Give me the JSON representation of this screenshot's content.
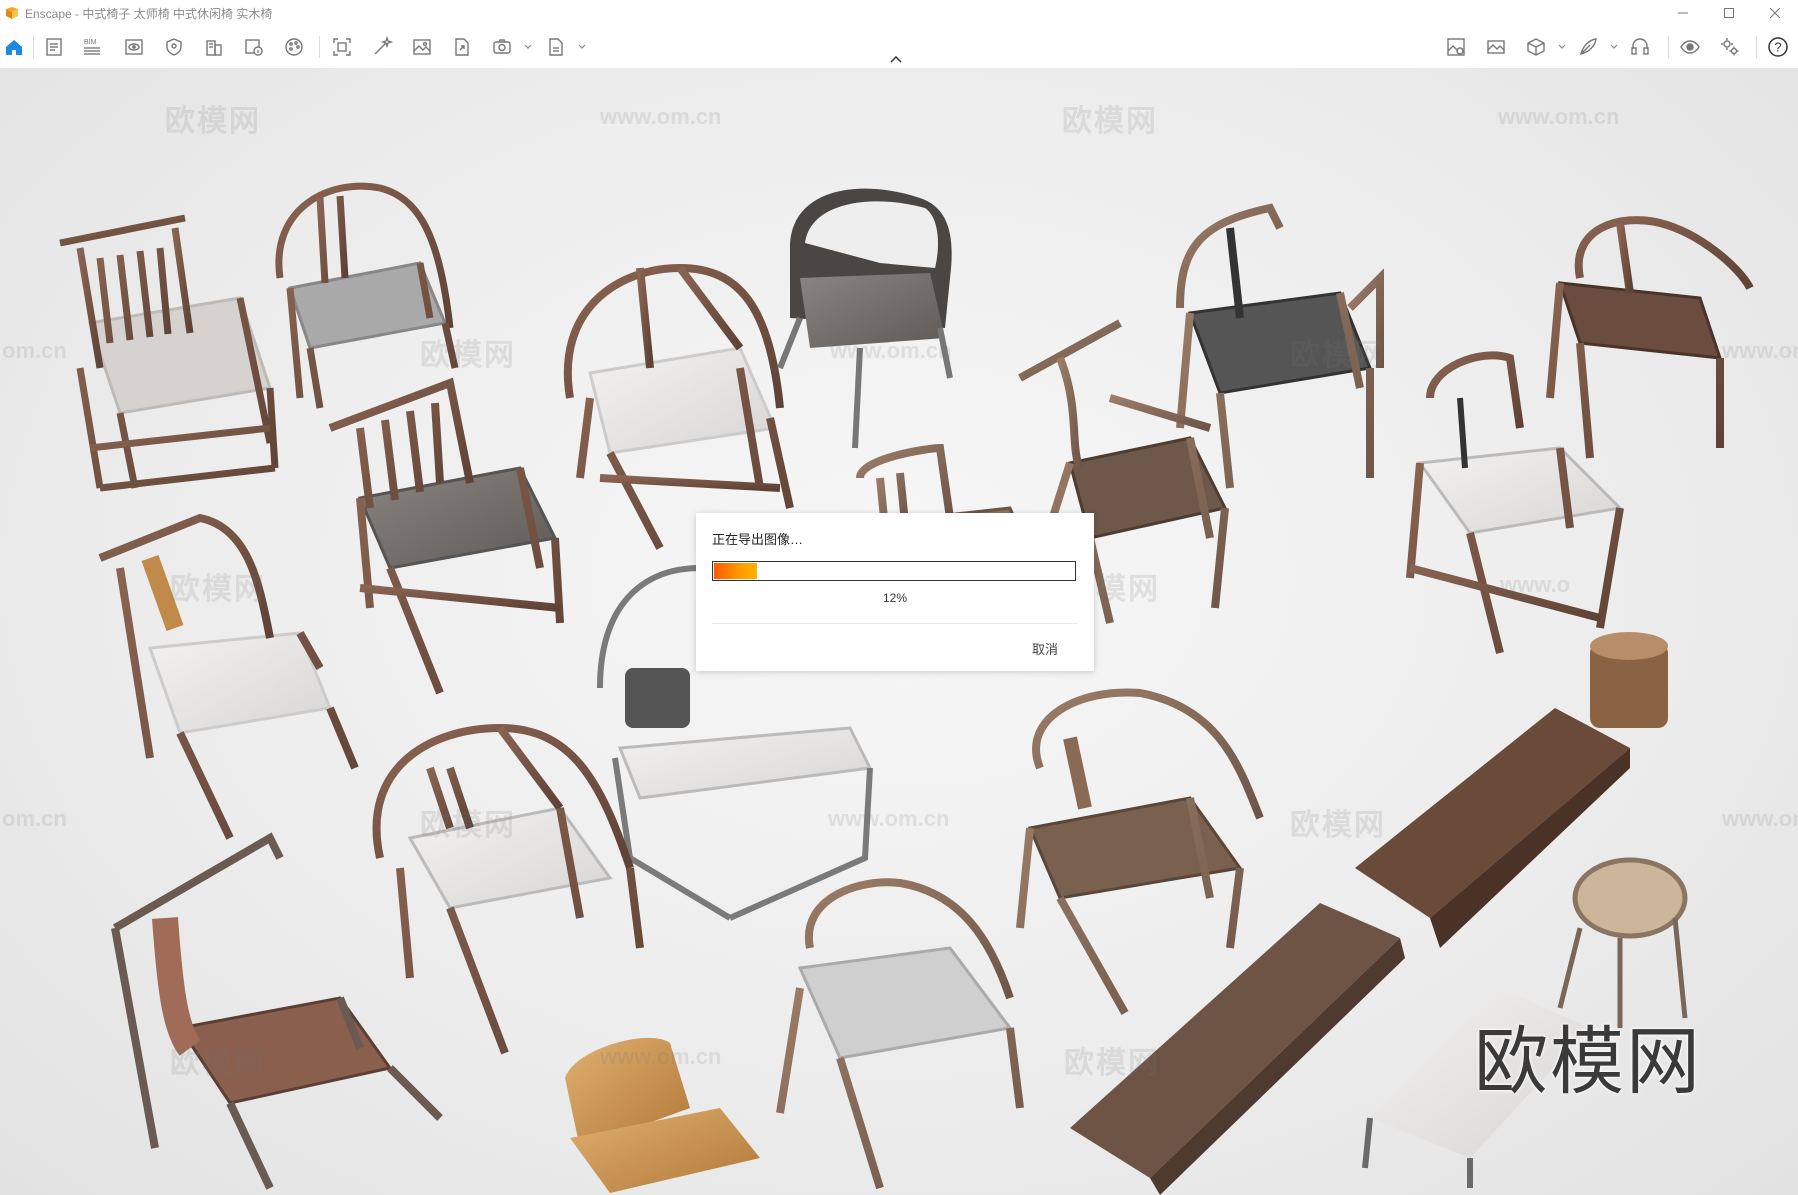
{
  "app": {
    "title": "Enscape - 中式椅子 太师椅 中式休闲椅 实木椅",
    "accent_color": "#f5a623"
  },
  "window_controls": {
    "minimize_icon": "minimize-icon",
    "maximize_icon": "maximize-icon",
    "close_icon": "close-icon"
  },
  "toolbar": {
    "bim_label": "BIM",
    "left_icons": [
      "home-icon",
      "sheet-icon",
      "bim-icon",
      "view-icon",
      "shield-icon",
      "building-icon",
      "info-image-icon",
      "palette-icon",
      "capture-icon",
      "magic-wand-icon",
      "image-icon",
      "export-file-icon",
      "camera-360-icon",
      "exe-file-icon"
    ],
    "right_icons": [
      "image-settings-icon",
      "panorama-icon",
      "cube-icon",
      "feather-icon",
      "headset-icon",
      "eye-icon",
      "settings-icon",
      "help-icon"
    ],
    "help_label": "?"
  },
  "watermarks": {
    "cn": "欧模网",
    "url": "www.om.cn",
    "partial_left": "om.cn",
    "partial_right": "www.o",
    "big": "欧模网"
  },
  "dialog": {
    "title": "正在导出图像…",
    "progress": 0.12,
    "percent_label": "12%",
    "cancel_label": "取消"
  }
}
